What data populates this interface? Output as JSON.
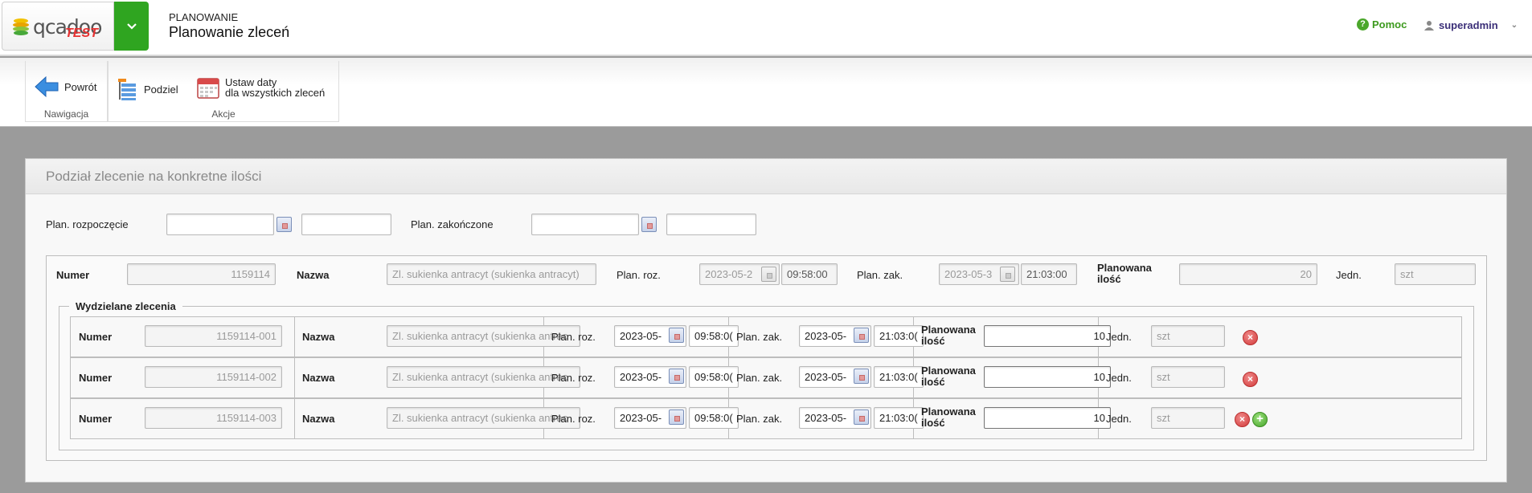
{
  "header": {
    "logo_text": "qcadoo",
    "logo_badge": "TEST",
    "section": "PLANOWANIE",
    "title": "Planowanie zleceń",
    "help_label": "Pomoc",
    "user_label": "superadmin"
  },
  "toolbar": {
    "groups": [
      {
        "label": "Nawigacja",
        "buttons": [
          {
            "label": "Powrót",
            "icon": "back-arrow-icon"
          }
        ]
      },
      {
        "label": "Akcje",
        "buttons": [
          {
            "label": "Podziel",
            "icon": "split-list-icon"
          },
          {
            "label_line1": "Ustaw daty",
            "label_line2": "dla wszystkich zleceń",
            "icon": "calendar-icon"
          }
        ]
      }
    ]
  },
  "panel": {
    "title": "Podział zlecenie na konkretne ilości",
    "filters": {
      "start_label": "Plan. rozpoczęcie",
      "start_date": "",
      "start_time": "",
      "end_label": "Plan. zakończone",
      "end_date": "",
      "end_time": ""
    },
    "order": {
      "number_label": "Numer",
      "number": "1159114",
      "name_label": "Nazwa",
      "name": "Zl. sukienka antracyt (sukienka antracyt)",
      "start_label": "Plan. roz.",
      "start_date": "2023-05-2",
      "start_time": "09:58:00",
      "end_label": "Plan. zak.",
      "end_date": "2023-05-3",
      "end_time": "21:03:00",
      "qty_label_line1": "Planowana",
      "qty_label_line2": "ilość",
      "qty": "20",
      "unit_label": "Jedn.",
      "unit": "szt"
    },
    "sub_orders_legend": "Wydzielane zlecenia",
    "sub_orders": [
      {
        "number_label": "Numer",
        "number": "1159114-001",
        "name_label": "Nazwa",
        "name": "Zl. sukienka antracyt (sukienka antrac",
        "start_label": "Plan. roz.",
        "start_date": "2023-05-",
        "start_time": "09:58:0(",
        "end_label": "Plan. zak.",
        "end_date": "2023-05-",
        "end_time": "21:03:0(",
        "qty_label_line1": "Planowana",
        "qty_label_line2": "ilość",
        "qty": "10",
        "unit_label": "Jedn.",
        "unit": "szt"
      },
      {
        "number_label": "Numer",
        "number": "1159114-002",
        "name_label": "Nazwa",
        "name": "Zl. sukienka antracyt (sukienka antrac",
        "start_label": "Plan. roz.",
        "start_date": "2023-05-",
        "start_time": "09:58:0(",
        "end_label": "Plan. zak.",
        "end_date": "2023-05-",
        "end_time": "21:03:0(",
        "qty_label_line1": "Planowana",
        "qty_label_line2": "ilość",
        "qty": "10",
        "unit_label": "Jedn.",
        "unit": "szt"
      },
      {
        "number_label": "Numer",
        "number": "1159114-003",
        "name_label": "Nazwa",
        "name": "Zl. sukienka antracyt (sukienka antrac",
        "start_label": "Plan. roz.",
        "start_date": "2023-05-",
        "start_time": "09:58:0(",
        "end_label": "Plan. zak.",
        "end_date": "2023-05-",
        "end_time": "21:03:0(",
        "qty_label_line1": "Planowana",
        "qty_label_line2": "ilość",
        "qty": "10",
        "unit_label": "Jedn.",
        "unit": "szt"
      }
    ]
  },
  "colors": {
    "brand_green": "#2fa520",
    "help_green": "#3d9a1e",
    "user_purple": "#3b2f78",
    "background_grey": "#9b9b9b"
  }
}
